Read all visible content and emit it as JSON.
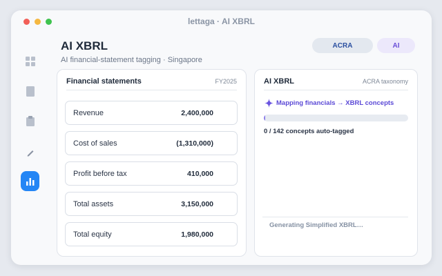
{
  "window": {
    "title": "lettaga · AI XBRL"
  },
  "sidebar": {
    "items": [
      {
        "icon": "dashboard-grid-icon",
        "active": false
      },
      {
        "icon": "document-icon",
        "active": false
      },
      {
        "icon": "clipboard-icon",
        "active": false
      },
      {
        "icon": "pencil-icon",
        "active": false
      },
      {
        "icon": "bar-chart-icon",
        "active": true
      }
    ],
    "accent": "#2486f5"
  },
  "header": {
    "title": "AI XBRL",
    "subtitle": "AI financial-statement tagging · Singapore",
    "buttons": {
      "acra": "ACRA",
      "ai": "AI"
    }
  },
  "statements": {
    "title": "Financial statements",
    "period": "FY2025",
    "rows": [
      {
        "label": "Revenue",
        "value": "2,400,000"
      },
      {
        "label": "Cost of sales",
        "value": "(1,310,000)"
      },
      {
        "label": "Profit before tax",
        "value": "410,000"
      },
      {
        "label": "Total assets",
        "value": "3,150,000"
      },
      {
        "label": "Total equity",
        "value": "1,980,000"
      }
    ]
  },
  "xbrl": {
    "title": "AI XBRL",
    "taxonomy": "ACRA taxonomy",
    "status": "Mapping financials → XBRL concepts",
    "progress_fraction": 0.0,
    "progress_text": "0 / 142 concepts auto-tagged",
    "footer": "Generating Simplified XBRL…",
    "accent": "#5b49d6"
  }
}
